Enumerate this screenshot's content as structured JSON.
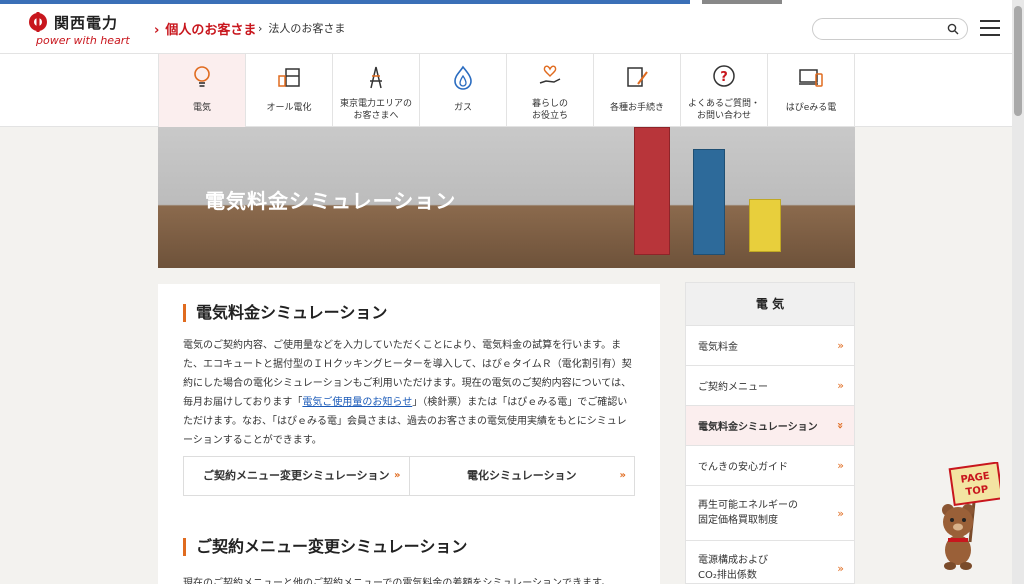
{
  "header": {
    "logo_text": "関西電力",
    "logo_sub": "power with heart",
    "nav_personal": "個人のお客さま",
    "nav_corporate": "法人のお客さま",
    "search": {
      "value": "",
      "placeholder": ""
    }
  },
  "categories": [
    {
      "label": "電気",
      "icon": "lightbulb-icon"
    },
    {
      "label": "オール電化",
      "icon": "appliance-icon"
    },
    {
      "label": "東京電力エリアの\nお客さまへ",
      "icon": "tower-icon"
    },
    {
      "label": "ガス",
      "icon": "flame-icon"
    },
    {
      "label": "暮らしの\nお役立ち",
      "icon": "hand-heart-icon"
    },
    {
      "label": "各種お手続き",
      "icon": "form-pen-icon"
    },
    {
      "label": "よくあるご質問・\nお問い合わせ",
      "icon": "question-bubble-icon"
    },
    {
      "label": "はぴeみる電",
      "icon": "devices-icon"
    }
  ],
  "hero": {
    "title": "電気料金シミュレーション"
  },
  "main": {
    "heading": "電気料金シミュレーション",
    "intro_part1": "電気のご契約内容、ご使用量などを入力していただくことにより、電気料金の試算を行います。また、エコキュートと据付型のＩＨクッキングヒーターを導入して、はぴｅタイムＲ（電化割引有）契約にした場合の電化シミュレーションもご利用いただけます。現在の電気のご契約内容については、毎月お届けしております「",
    "intro_link": "電気ご使用量のお知らせ",
    "intro_part2": "」（検針票）または「はぴｅみる電」でご確認いただけます。なお、「はぴｅみる電」会員さまは、過去のお客さまの電気使用実績をもとにシミュレーションすることができます。",
    "tab1": "ご契約メニュー変更シミュレーション",
    "tab2": "電化シミュレーション",
    "heading2": "ご契約メニュー変更シミュレーション",
    "cut_text": "現在のご契約メニューと他のご契約メニューでの電気料金の差額をシミュレーションできます。"
  },
  "sidebar": {
    "heading": "電 気",
    "items": [
      {
        "label": "電気料金"
      },
      {
        "label": "ご契約メニュー"
      },
      {
        "label": "電気料金シミュレーション"
      },
      {
        "label": "でんきの安心ガイド"
      },
      {
        "label": "再生可能エネルギーの\n固定価格買取制度"
      },
      {
        "label": "電源構成および\nCO₂排出係数"
      }
    ]
  },
  "pagetop": {
    "label1": "PAGE",
    "label2": "TOP"
  },
  "colors": {
    "accent": "#e06b1f",
    "brand_red": "#c8161d",
    "link": "#1a5ab8"
  }
}
